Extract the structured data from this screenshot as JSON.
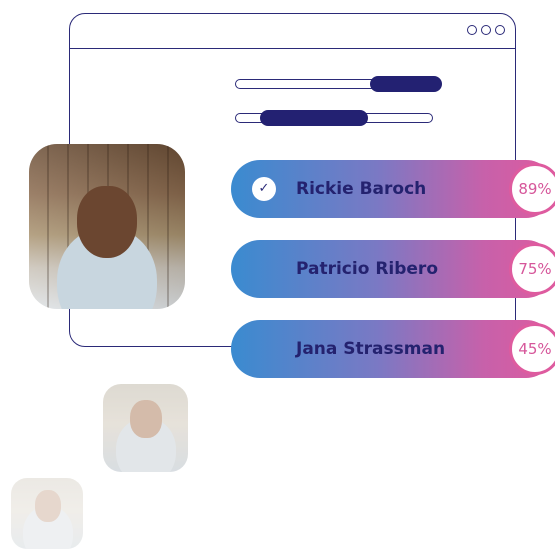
{
  "window": {
    "controls": [
      "circle-icon",
      "circle-icon",
      "circle-icon"
    ]
  },
  "sliders": [
    {
      "fill_fraction": 0.34
    },
    {
      "fill_fraction": 0.54
    }
  ],
  "results": [
    {
      "name": "Rickie Baroch",
      "percent": "89%",
      "selected": true,
      "check": "✓"
    },
    {
      "name": "Patricio Ribero",
      "percent": "75%",
      "selected": false
    },
    {
      "name": "Jana Strassman",
      "percent": "45%",
      "selected": false
    }
  ],
  "colors": {
    "navy": "#2b2a78",
    "blue": "#3a8bd0",
    "pink": "#de5b9f"
  }
}
